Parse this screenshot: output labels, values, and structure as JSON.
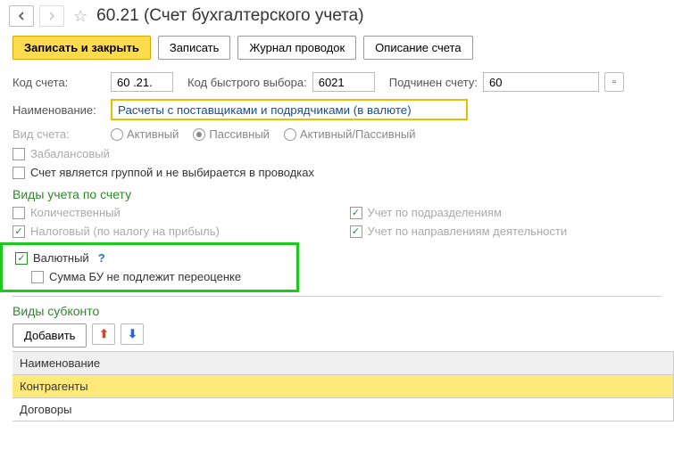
{
  "header": {
    "title": "60.21 (Счет бухгалтерского учета)"
  },
  "toolbar": {
    "save_close": "Записать и закрыть",
    "save": "Записать",
    "journal": "Журнал проводок",
    "description": "Описание счета"
  },
  "fields": {
    "code_label": "Код счета:",
    "code_value": "60 .21.",
    "quick_label": "Код быстрого выбора:",
    "quick_value": "6021",
    "parent_label": "Подчинен счету:",
    "parent_value": "60",
    "name_label": "Наименование:",
    "name_value": "Расчеты с поставщиками и подрядчиками (в валюте)",
    "type_label": "Вид счета:",
    "type_active": "Активный",
    "type_passive": "Пассивный",
    "type_both": "Активный/Пассивный"
  },
  "checkboxes": {
    "offbalance": "Забалансовый",
    "group": "Счет является группой и не выбирается в проводках"
  },
  "accounting_types": {
    "title": "Виды учета по счету",
    "quantity": "Количественный",
    "tax": "Налоговый (по налогу на прибыль)",
    "dept": "Учет по подразделениям",
    "direction": "Учет по направлениям деятельности",
    "currency": "Валютный",
    "no_reval": "Сумма БУ не подлежит переоценке"
  },
  "subconto": {
    "title": "Виды субконто",
    "add": "Добавить",
    "header": "Наименование",
    "rows": [
      "Контрагенты",
      "Договоры"
    ]
  }
}
